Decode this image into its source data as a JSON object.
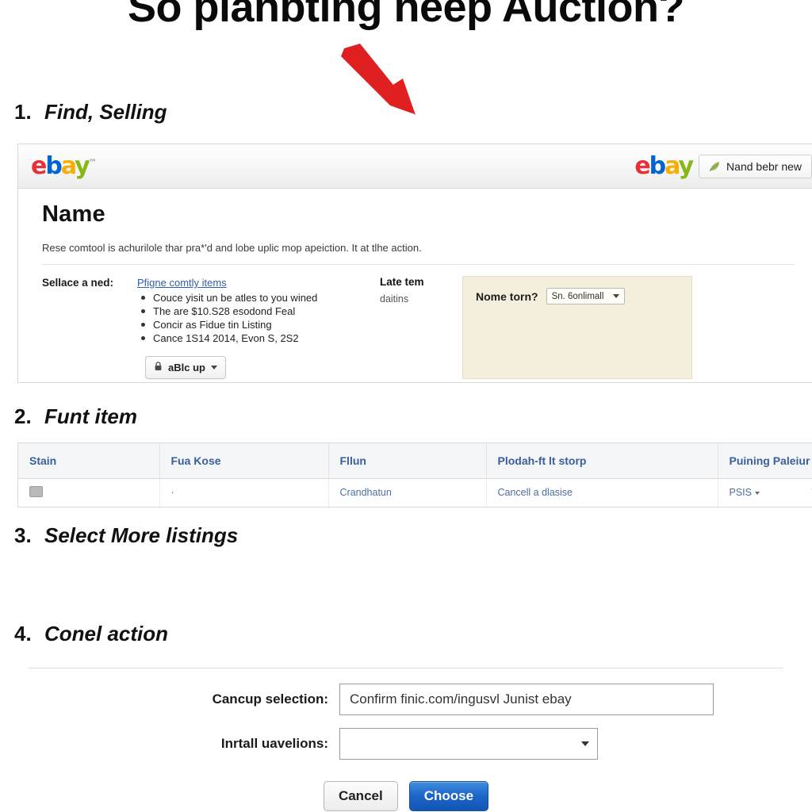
{
  "page": {
    "title": "So planbtlng neep Auction?",
    "arrow_color": "#e02020"
  },
  "steps": [
    {
      "num": "1.",
      "label": "Find, Selling"
    },
    {
      "num": "2.",
      "label": "Funt item"
    },
    {
      "num": "3.",
      "label": "Select More listings"
    },
    {
      "num": "4.",
      "label": "Conel action"
    }
  ],
  "ebay_panel": {
    "logo_left": {
      "e": "e",
      "b": "b",
      "a": "a",
      "y": "y",
      "tm": "™"
    },
    "logo_right": {
      "e": "e",
      "b": "b",
      "a": "a",
      "y": "y"
    },
    "nav_pill_label": "Nand bebr new",
    "heading": "Name",
    "description": "Rese comtool is achurilole thar pra*'d and lobe uplic mop apeiction. It at tlhe action.",
    "row_label": "Sellace a ned:",
    "list_link": "Pfigne comtly items",
    "bullets": [
      "Couce yisit un be atles to you wined",
      "The are $10.S28 esodond Feal",
      "Concir as Fidue tin Listing",
      "Cance 1S14 2014, Evon S, 2S2"
    ],
    "action_button": "aBlc up",
    "mid_title": "Late tem",
    "mid_sub": "daitins",
    "beige": {
      "question": "Nome torn?",
      "select_value": "Sn. 6onlimall"
    }
  },
  "table": {
    "headers": [
      "Stain",
      "Fua Kose",
      "Fllun",
      "Plodah-ft lt storp",
      "Puining Paleiur",
      ""
    ],
    "row": {
      "thumb": "thumbnail",
      "col2": "·",
      "col3": "Crandhatun",
      "col4": "Cancell a dlasise",
      "col5": "PSIS",
      "col6": "Th"
    }
  },
  "dialog": {
    "fields": [
      {
        "label": "Cancup selection:",
        "value": "Confirm finic.com/ingusvl Junist ebay",
        "type": "text"
      },
      {
        "label": "Inrtall uavelions:",
        "value": "",
        "type": "select"
      }
    ],
    "cancel_label": "Cancel",
    "confirm_label": "Choose",
    "confirm_color": "#1d64c6"
  }
}
